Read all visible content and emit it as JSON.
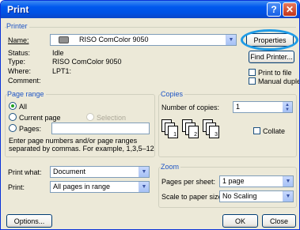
{
  "window": {
    "title": "Print",
    "help": "?",
    "close": "✕"
  },
  "printer": {
    "group": "Printer",
    "name_label": "Name:",
    "name_value": "RISO ComColor 9050",
    "status_label": "Status:",
    "status_value": "Idle",
    "type_label": "Type:",
    "type_value": "RISO ComColor 9050",
    "where_label": "Where:",
    "where_value": "LPT1:",
    "comment_label": "Comment:",
    "properties": "Properties",
    "find_printer": "Find Printer...",
    "print_to_file": "Print to file",
    "manual_duplex": "Manual duplex",
    "highlight_color": "#1e9be6"
  },
  "page_range": {
    "group": "Page range",
    "all": "All",
    "current_page": "Current page",
    "selection": "Selection",
    "pages": "Pages:",
    "help_text_1": "Enter page numbers and/or page ranges",
    "help_text_2": "separated by commas. For example, 1,3,5–12"
  },
  "copies": {
    "group": "Copies",
    "number_label": "Number of copies:",
    "number_value": "1",
    "collate": "Collate",
    "pages": [
      "1",
      "2",
      "3"
    ]
  },
  "print_what": {
    "label": "Print what:",
    "value": "Document"
  },
  "print_range": {
    "label": "Print:",
    "value": "All pages in range"
  },
  "zoom": {
    "group": "Zoom",
    "pages_per_sheet_label": "Pages per sheet:",
    "pages_per_sheet_value": "1 page",
    "scale_label": "Scale to paper size:",
    "scale_value": "No Scaling"
  },
  "footer": {
    "options": "Options...",
    "ok": "OK",
    "close": "Close"
  }
}
